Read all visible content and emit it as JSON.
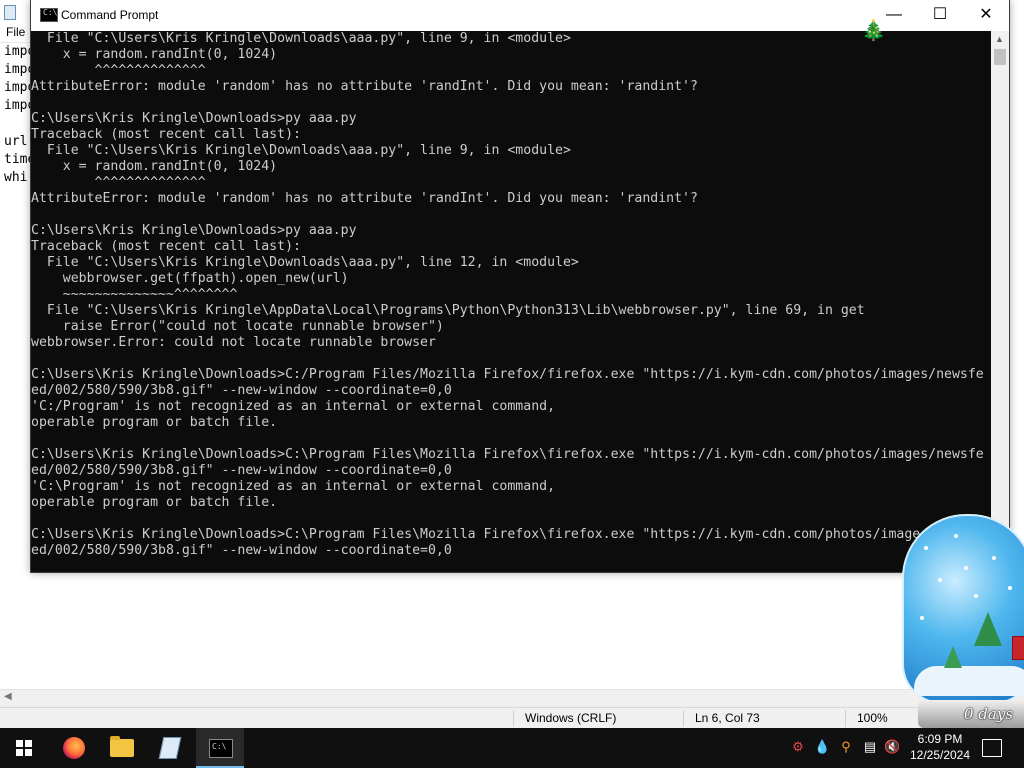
{
  "notepad": {
    "menu_file": "File",
    "lines": [
      "impo",
      "impo",
      "impo",
      "impo",
      "",
      "url",
      "time",
      "whi"
    ],
    "status": {
      "line_ending": "Windows (CRLF)",
      "position": "Ln 6, Col 73",
      "zoom": "100%"
    }
  },
  "cmd": {
    "title": "Command Prompt",
    "icon": "C:\\",
    "output": [
      "  File \"C:\\Users\\Kris Kringle\\Downloads\\aaa.py\", line 9, in <module>",
      "    x = random.randInt(0, 1024)",
      "        ^^^^^^^^^^^^^^",
      "AttributeError: module 'random' has no attribute 'randInt'. Did you mean: 'randint'?",
      "",
      "C:\\Users\\Kris Kringle\\Downloads>py aaa.py",
      "Traceback (most recent call last):",
      "  File \"C:\\Users\\Kris Kringle\\Downloads\\aaa.py\", line 9, in <module>",
      "    x = random.randInt(0, 1024)",
      "        ^^^^^^^^^^^^^^",
      "AttributeError: module 'random' has no attribute 'randInt'. Did you mean: 'randint'?",
      "",
      "C:\\Users\\Kris Kringle\\Downloads>py aaa.py",
      "Traceback (most recent call last):",
      "  File \"C:\\Users\\Kris Kringle\\Downloads\\aaa.py\", line 12, in <module>",
      "    webbrowser.get(ffpath).open_new(url)",
      "    ~~~~~~~~~~~~~~^^^^^^^^",
      "  File \"C:\\Users\\Kris Kringle\\AppData\\Local\\Programs\\Python\\Python313\\Lib\\webbrowser.py\", line 69, in get",
      "    raise Error(\"could not locate runnable browser\")",
      "webbrowser.Error: could not locate runnable browser",
      "",
      "C:\\Users\\Kris Kringle\\Downloads>C:/Program Files/Mozilla Firefox/firefox.exe \"https://i.kym-cdn.com/photos/images/newsfe",
      "ed/002/580/590/3b8.gif\" --new-window --coordinate=0,0",
      "'C:/Program' is not recognized as an internal or external command,",
      "operable program or batch file.",
      "",
      "C:\\Users\\Kris Kringle\\Downloads>C:\\Program Files\\Mozilla Firefox\\firefox.exe \"https://i.kym-cdn.com/photos/images/newsfe",
      "ed/002/580/590/3b8.gif\" --new-window --coordinate=0,0",
      "'C:\\Program' is not recognized as an internal or external command,",
      "operable program or batch file.",
      "",
      "C:\\Users\\Kris Kringle\\Downloads>C:\\Program Files\\Mozilla Firefox\\firefox.exe \"https://i.kym-cdn.com/photos/images/",
      "ed/002/580/590/3b8.gif\" --new-window --coordinate=0,0"
    ]
  },
  "widget": {
    "days_text": "0 days"
  },
  "taskbar": {
    "time": "6:09 PM",
    "date": "12/25/2024",
    "apps": [
      "start-icon",
      "firefox-icon",
      "file-explorer-icon",
      "notepad-icon",
      "command-prompt-icon"
    ],
    "tray": [
      "network-sharing-icon",
      "water-drop-icon",
      "search-icon",
      "network-icon",
      "volume-muted-icon",
      "notification-icon"
    ]
  }
}
